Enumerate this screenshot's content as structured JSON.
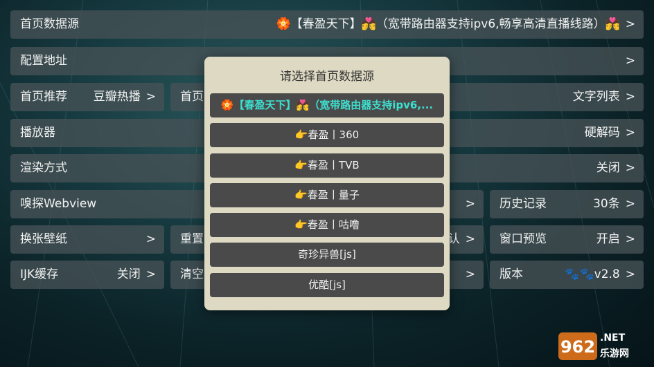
{
  "settings": {
    "home_source": {
      "label": "首页数据源",
      "value": "🏵️【春盈天下】💏（宽带路由器支持ipv6,畅享高清直播线路）💏",
      "arrow": ">"
    },
    "config_address": {
      "label": "配置地址",
      "arrow": ">"
    },
    "home_recommend": {
      "label": "首页推荐",
      "value": "豆瓣热播",
      "arrow": ">"
    },
    "home_style": {
      "label": "首页",
      "value": "文字列表",
      "arrow": ">"
    },
    "player": {
      "label": "播放器",
      "value": "硬解码",
      "arrow": ">"
    },
    "render_mode": {
      "label": "渲染方式",
      "value": "关闭",
      "arrow": ">"
    },
    "sniff_webview": {
      "label": "嗅探Webview",
      "arrow": ">"
    },
    "history": {
      "label": "历史记录",
      "value": "30条",
      "arrow": ">"
    },
    "change_wallpaper": {
      "label": "换张壁纸",
      "arrow": ">"
    },
    "reset": {
      "label": "重置",
      "value": "认",
      "arrow": ">"
    },
    "window_preview": {
      "label": "窗口预览",
      "value": "开启",
      "arrow": ">"
    },
    "ijk_cache": {
      "label": "IJK缓存",
      "value": "关闭",
      "arrow": ">"
    },
    "clear": {
      "label": "清空",
      "arrow": ">"
    },
    "version": {
      "label": "版本",
      "value": "🐾🐾v2.8",
      "arrow": ">"
    }
  },
  "dialog": {
    "title": "请选择首页数据源",
    "options": [
      {
        "text": "🏵️【春盈天下】💏（宽带路由器支持ipv6,...",
        "selected": true
      },
      {
        "text": "👉春盈丨360",
        "selected": false
      },
      {
        "text": "👉春盈丨TVB",
        "selected": false
      },
      {
        "text": "👉春盈丨量子",
        "selected": false
      },
      {
        "text": "👉春盈丨咕噜",
        "selected": false
      },
      {
        "text": "奇珍异兽[js]",
        "selected": false
      },
      {
        "text": "优酷[js]",
        "selected": false
      }
    ]
  },
  "watermark": {
    "top": "962.NET",
    "bottom": "乐游网"
  },
  "colors": {
    "selected_option": "#3de0d0",
    "dialog_bg": "#ddd9c2",
    "option_bg": "#4a4a4a"
  }
}
